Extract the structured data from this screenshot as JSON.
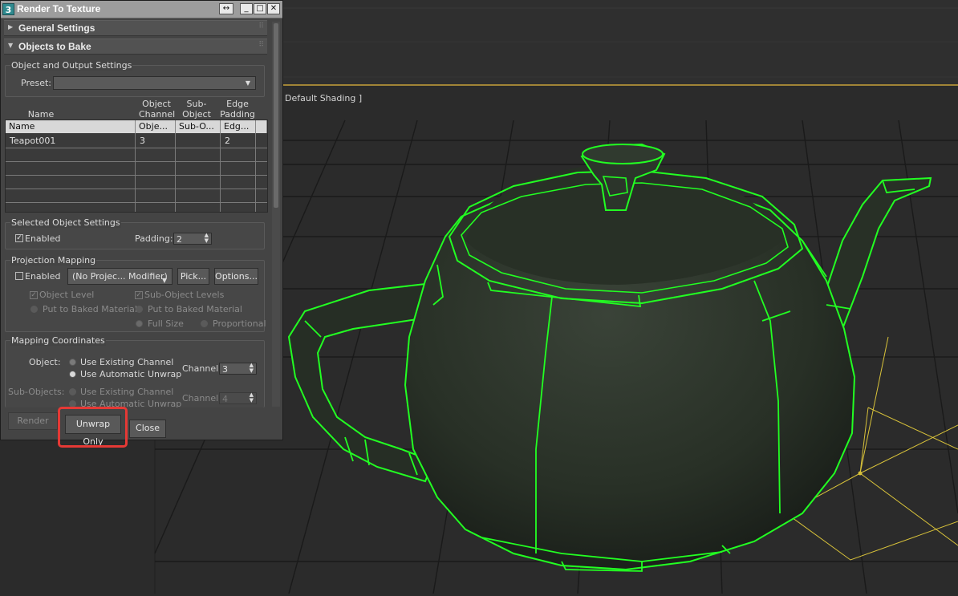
{
  "dialog": {
    "title": "Render To Texture",
    "app_icon": "3",
    "window_buttons": {
      "resize": "↔",
      "minimize": "_",
      "maximize": "□",
      "close": "✕"
    },
    "rollouts": {
      "general": "General Settings",
      "objects": "Objects to Bake"
    }
  },
  "output_settings": {
    "group_title": "Object and Output Settings",
    "preset_label": "Preset:",
    "preset_value": ""
  },
  "table": {
    "head_labels": [
      "Name",
      "Object\nChannel",
      "Sub-Object\nChannel",
      "Edge\nPadding"
    ],
    "columns": [
      "Name",
      "Obje...",
      "Sub-O...",
      "Edg..."
    ],
    "rows": [
      [
        "Teapot001",
        "3",
        "",
        "2"
      ]
    ]
  },
  "selected_object": {
    "group_title": "Selected Object Settings",
    "enabled_label": "Enabled",
    "enabled_checked": true,
    "padding_label": "Padding:",
    "padding_value": "2"
  },
  "projection": {
    "group_title": "Projection Mapping",
    "enabled_label": "Enabled",
    "modifier_value": "(No Projec... Modifier)",
    "pick_label": "Pick...",
    "options_label": "Options...",
    "object_level": "Object Level",
    "sub_object_levels": "Sub-Object Levels",
    "put_baked_left": "Put to Baked Material",
    "put_baked_right": "Put to Baked Material",
    "full_size": "Full Size",
    "proportional": "Proportional"
  },
  "mapping": {
    "group_title": "Mapping Coordinates",
    "object_label": "Object:",
    "use_existing": "Use Existing Channel",
    "use_auto": "Use Automatic Unwrap",
    "channel_label": "Channel:",
    "channel_value": "3",
    "sub_objects_label": "Sub-Objects:",
    "sub_use_existing": "Use Existing Channel",
    "sub_use_auto": "Use Automatic Unwrap",
    "sub_channel_label": "Channel:",
    "sub_channel_value": "4"
  },
  "footer": {
    "render": "Render",
    "unwrap_only": "Unwrap Only",
    "close": "Close"
  },
  "viewport": {
    "label": "Default Shading ]",
    "colors": {
      "background": "#2b2b2b",
      "wireframe": "#22ff22",
      "teapot": "#2a3329",
      "gizmo": "#d8c23a"
    }
  }
}
